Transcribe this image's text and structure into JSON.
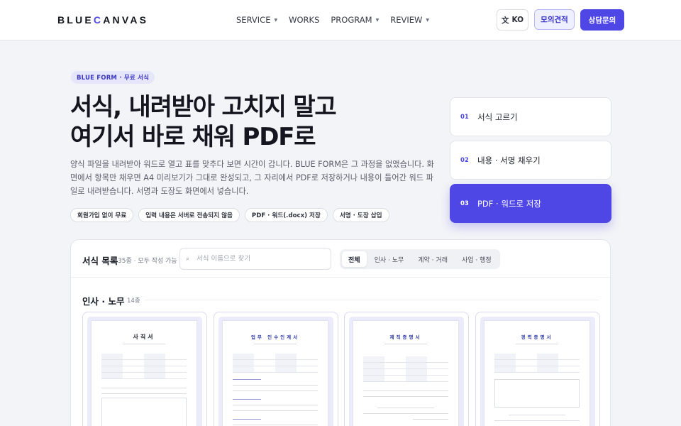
{
  "header": {
    "logo_pre": "BLUE",
    "logo_c": "C",
    "logo_post": "ANVAS",
    "nav": [
      {
        "label": "SERVICE",
        "dropdown": true
      },
      {
        "label": "WORKS",
        "dropdown": false
      },
      {
        "label": "PROGRAM",
        "dropdown": true
      },
      {
        "label": "REVIEW",
        "dropdown": true
      }
    ],
    "lang_icon": "文",
    "lang_label": "KO",
    "quote_label": "모의견적",
    "consult_label": "상담문의"
  },
  "hero": {
    "badge": "BLUE FORM · 무료 서식",
    "title_line1": "서식, 내려받아 고치지 말고",
    "title_line2": "여기서 바로 채워 PDF로",
    "description": "양식 파일을 내려받아 워드로 열고 표를 맞추다 보면 시간이 갑니다. BLUE FORM은 그 과정을 없앴습니다. 화면에서 항목만 채우면 A4 미리보기가 그대로 완성되고, 그 자리에서 PDF로 저장하거나 내용이 들어간 워드 파일로 내려받습니다. 서명과 도장도 화면에서 넣습니다.",
    "chips": [
      "회원가입 없이 무료",
      "입력 내용은 서버로 전송되지 않음",
      "PDF · 워드(.docx) 저장",
      "서명 · 도장 삽입"
    ]
  },
  "steps": [
    {
      "num": "01",
      "label": "서식 고르기",
      "active": false
    },
    {
      "num": "02",
      "label": "내용 · 서명 채우기",
      "active": false
    },
    {
      "num": "03",
      "label": "PDF · 워드로 저장",
      "active": true
    }
  ],
  "form_list": {
    "title": "서식 목록",
    "count": "35종 · 모두 작성 가능",
    "search_placeholder": "서식 이름으로 찾기",
    "search_icon": "⌕",
    "tabs": [
      {
        "label": "전체",
        "active": true
      },
      {
        "label": "인사 · 노무",
        "active": false
      },
      {
        "label": "계약 · 거래",
        "active": false
      },
      {
        "label": "사업 · 행정",
        "active": false
      }
    ],
    "section_title": "인사 · 노무",
    "section_count": "14종",
    "cards": [
      {
        "doc_title": "사직서"
      },
      {
        "doc_title": "업무 인수인계서"
      },
      {
        "doc_title": "재직증명서"
      },
      {
        "doc_title": "경력증명서"
      }
    ]
  },
  "colors": {
    "accent": "#4e47e6",
    "badge_bg": "#e6e6fb",
    "page_bg": "#f3f4f7"
  }
}
